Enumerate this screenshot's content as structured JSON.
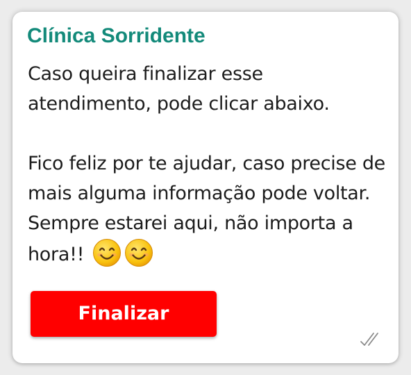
{
  "message_card": {
    "sender": "Clínica Sorridente",
    "body_line1": "Caso queira finalizar esse atendimento, pode clicar abaixo.",
    "body_line2": "Fico feliz por te ajudar, caso precise de mais alguma informação pode voltar. Sempre estarei aqui, não importa a hora!!",
    "emojis": [
      "smiling-face-icon",
      "smiling-face-icon"
    ],
    "status_icon": "double-check-icon"
  },
  "actions": {
    "finalize_label": "Finalizar"
  },
  "colors": {
    "sender": "#138a7a",
    "button": "#ff0000",
    "button_text": "#ffffff",
    "card_bg": "#ffffff"
  }
}
